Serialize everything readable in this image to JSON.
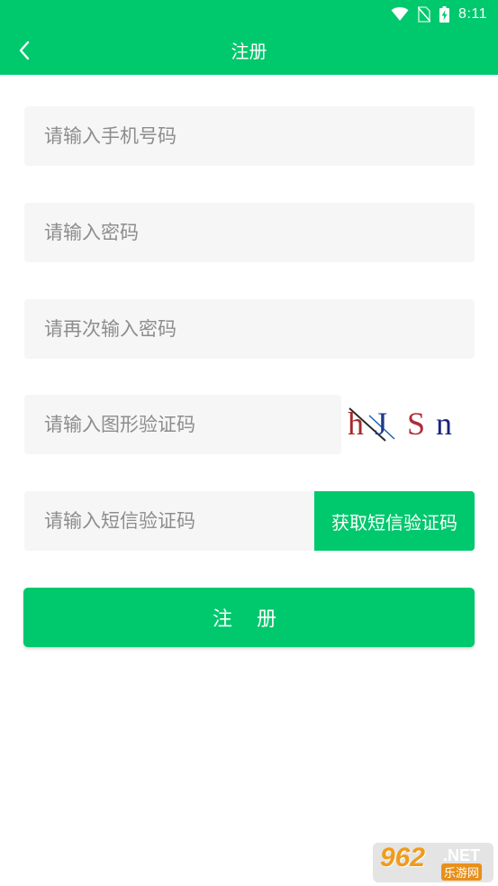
{
  "status_bar": {
    "time": "8:11",
    "icons": [
      "wifi-icon",
      "no-sim-icon",
      "battery-charging-icon"
    ]
  },
  "header": {
    "title": "注册",
    "back_icon": "chevron-left-icon"
  },
  "form": {
    "phone_placeholder": "请输入手机号码",
    "password_placeholder": "请输入密码",
    "confirm_password_placeholder": "请再次输入密码",
    "image_captcha_placeholder": "请输入图形验证码",
    "captcha_image_text": [
      "h",
      "J",
      "S",
      "n"
    ],
    "sms_code_placeholder": "请输入短信验证码",
    "sms_button_label": "获取短信验证码",
    "submit_label": "注 册"
  },
  "watermark": {
    "number": "962",
    "domain": ".NET",
    "site_cn": "乐游网"
  },
  "colors": {
    "accent": "#00c86d",
    "field_bg": "#f6f6f6",
    "placeholder": "#8d8d8d"
  }
}
